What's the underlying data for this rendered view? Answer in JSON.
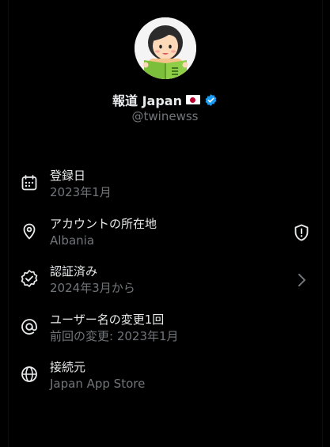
{
  "profile": {
    "name": "報道 Japan",
    "handle": "@twinewss",
    "avatar_icon": "avatar-girl-reading-book",
    "verified_icon": "verified-badge-icon",
    "verified_color": "#1d9bf0"
  },
  "details": [
    {
      "icon": "calendar-icon",
      "title": "登録日",
      "value": "2023年1月"
    },
    {
      "icon": "location-pin-icon",
      "title": "アカウントの所在地",
      "value": "Albania",
      "trailing_icon": "shield-alert-icon"
    },
    {
      "icon": "verified-check-icon",
      "title": "認証済み",
      "value": "2024年3月から",
      "trailing_icon": "chevron-right-icon"
    },
    {
      "icon": "at-sign-icon",
      "title": "ユーザー名の変更1回",
      "value": "前回の変更: 2023年1月"
    },
    {
      "icon": "globe-icon",
      "title": "接続元",
      "value": "Japan App Store"
    }
  ],
  "colors": {
    "background": "#000000",
    "primary_text": "#e7e9ea",
    "secondary_text": "#71767b",
    "accent": "#1d9bf0"
  }
}
